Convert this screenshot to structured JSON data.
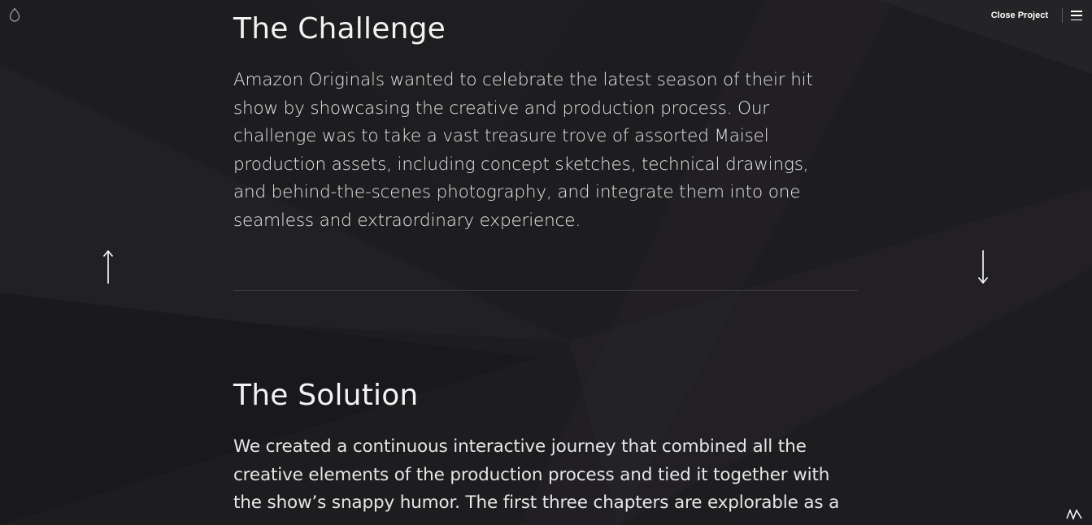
{
  "header": {
    "close_label": "Close Project",
    "icons": {
      "logo": "drop-logo-icon",
      "menu": "hamburger-menu-icon",
      "brand": "brand-mark-icon"
    }
  },
  "navigation": {
    "prev_icon": "arrow-up-icon",
    "next_icon": "arrow-down-icon"
  },
  "sections": {
    "challenge": {
      "title": "The Challenge",
      "lines": [
        "Amazon Originals wanted to celebrate the latest season of their hit",
        "show by showcasing the creative and production process. Our",
        "challenge was to take a vast treasure trove of assorted Maisel",
        "production assets, including concept sketches, technical drawings,",
        "and behind-the-scenes photography, and integrate them into one",
        "seamless and extraordinary experience."
      ]
    },
    "solution": {
      "title": "The Solution",
      "lines": [
        "We created a continuous interactive journey that combined all the",
        "creative elements of the production process and tied it together with",
        "the show’s snappy humor. The first three chapters are explorable as a"
      ]
    }
  },
  "colors": {
    "background": "#1d1c1f",
    "text": "#e6e6e6",
    "divider": "#3a393d",
    "accent": "#ffffff"
  }
}
